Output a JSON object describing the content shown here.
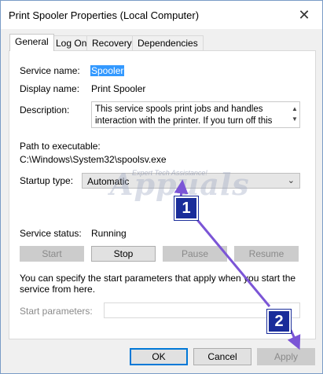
{
  "window": {
    "title": "Print Spooler Properties (Local Computer)",
    "close_glyph": "✕"
  },
  "tabs": [
    {
      "label": "General",
      "active": true
    },
    {
      "label": "Log On",
      "active": false
    },
    {
      "label": "Recovery",
      "active": false
    },
    {
      "label": "Dependencies",
      "active": false
    }
  ],
  "general": {
    "service_name_label": "Service name:",
    "service_name_value": "Spooler",
    "display_name_label": "Display name:",
    "display_name_value": "Print Spooler",
    "description_label": "Description:",
    "description_value": "This service spools print jobs and handles interaction with the printer.  If you turn off this service, you won't",
    "path_label": "Path to executable:",
    "path_value": "C:\\Windows\\System32\\spoolsv.exe",
    "startup_type_label": "Startup type:",
    "startup_type_value": "Automatic",
    "service_status_label": "Service status:",
    "service_status_value": "Running",
    "buttons": {
      "start": "Start",
      "stop": "Stop",
      "pause": "Pause",
      "resume": "Resume"
    },
    "params_help": "You can specify the start parameters that apply when you start the service from here.",
    "start_parameters_label": "Start parameters:",
    "start_parameters_value": ""
  },
  "dialog_buttons": {
    "ok": "OK",
    "cancel": "Cancel",
    "apply": "Apply"
  },
  "annotations": {
    "badge_1": "1",
    "badge_2": "2"
  },
  "watermark": {
    "main": "Appuals",
    "sub": "Expert Tech Assistance!"
  },
  "colors": {
    "selection": "#3399ff",
    "annotation": "#1a2d9a",
    "arrow": "#7b55d6"
  }
}
